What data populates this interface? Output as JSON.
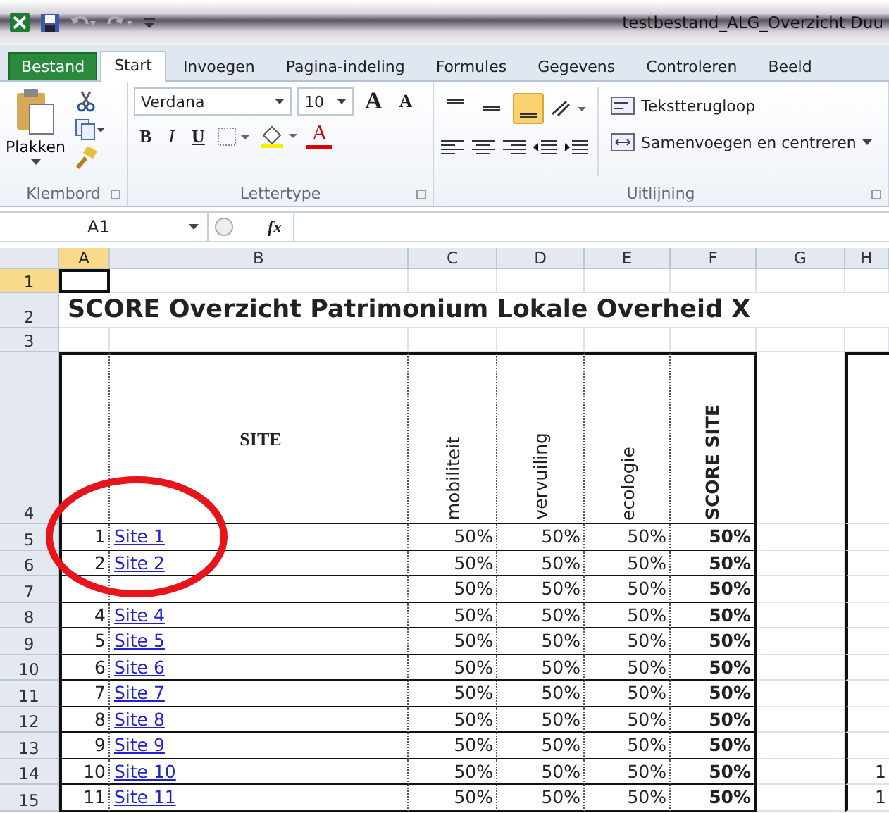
{
  "window": {
    "title": "testbestand_ALG_Overzicht Duu"
  },
  "tabs": [
    {
      "label": "Bestand",
      "kind": "file",
      "selected": false
    },
    {
      "label": "Start",
      "kind": "tab",
      "selected": true
    },
    {
      "label": "Invoegen",
      "kind": "tab",
      "selected": false
    },
    {
      "label": "Pagina-indeling",
      "kind": "tab",
      "selected": false
    },
    {
      "label": "Formules",
      "kind": "tab",
      "selected": false
    },
    {
      "label": "Gegevens",
      "kind": "tab",
      "selected": false
    },
    {
      "label": "Controleren",
      "kind": "tab",
      "selected": false
    },
    {
      "label": "Beeld",
      "kind": "tab",
      "selected": false
    }
  ],
  "ribbon": {
    "clipboard": {
      "paste": "Plakken",
      "group": "Klembord"
    },
    "font": {
      "family": "Verdana",
      "size": "10",
      "grow": "A",
      "shrink": "A",
      "bold": "B",
      "italic": "I",
      "underline": "U",
      "color_button": "A",
      "group": "Lettertype"
    },
    "alignment": {
      "vertical_align": [
        {
          "selected": false
        },
        {
          "selected": false
        },
        {
          "selected": true
        }
      ],
      "wrap": "Tekstterugloop",
      "merge": "Samenvoegen en centreren",
      "group": "Uitlijning"
    }
  },
  "formula_bar": {
    "name_box": "A1",
    "fx": "fx"
  },
  "sheet": {
    "columns": [
      {
        "label": "A",
        "selected": true
      },
      {
        "label": "B",
        "selected": false
      },
      {
        "label": "C",
        "selected": false
      },
      {
        "label": "D",
        "selected": false
      },
      {
        "label": "E",
        "selected": false
      },
      {
        "label": "F",
        "selected": false
      },
      {
        "label": "G",
        "selected": false
      },
      {
        "label": "H",
        "selected": false
      }
    ],
    "title_row": {
      "row": "2",
      "text": "SCORE Overzicht Patrimonium Lokale Overheid X"
    },
    "blank_rows": [
      {
        "row": "1",
        "selected": true
      },
      {
        "row": "3",
        "selected": false
      }
    ],
    "header": {
      "row": "4",
      "site": "SITE",
      "criteria": [
        "mobiliteit",
        "vervuiling",
        "ecologie"
      ],
      "score": "SCORE SITE"
    },
    "rows": [
      {
        "row": "5",
        "nr": "1",
        "site": "Site 1",
        "values": [
          "50%",
          "50%",
          "50%"
        ],
        "score": "50%"
      },
      {
        "row": "6",
        "nr": "2",
        "site": "Site 2",
        "values": [
          "50%",
          "50%",
          "50%"
        ],
        "score": "50%"
      },
      {
        "row": "7",
        "values": [
          "50%",
          "50%",
          "50%"
        ],
        "score": "50%"
      },
      {
        "row": "8",
        "nr": "4",
        "site": "Site 4",
        "values": [
          "50%",
          "50%",
          "50%"
        ],
        "score": "50%"
      },
      {
        "row": "9",
        "nr": "5",
        "site": "Site 5",
        "values": [
          "50%",
          "50%",
          "50%"
        ],
        "score": "50%"
      },
      {
        "row": "10",
        "nr": "6",
        "site": "Site 6",
        "values": [
          "50%",
          "50%",
          "50%"
        ],
        "score": "50%"
      },
      {
        "row": "11",
        "nr": "7",
        "site": "Site 7",
        "values": [
          "50%",
          "50%",
          "50%"
        ],
        "score": "50%"
      },
      {
        "row": "12",
        "nr": "8",
        "site": "Site 8",
        "values": [
          "50%",
          "50%",
          "50%"
        ],
        "score": "50%"
      },
      {
        "row": "13",
        "nr": "9",
        "site": "Site 9",
        "values": [
          "50%",
          "50%",
          "50%"
        ],
        "score": "50%"
      },
      {
        "row": "14",
        "nr": "10",
        "site": "Site 10",
        "values": [
          "50%",
          "50%",
          "50%"
        ],
        "score": "50%",
        "column_h": "1"
      },
      {
        "row": "15",
        "nr": "11",
        "site": "Site 11",
        "values": [
          "50%",
          "50%",
          "50%"
        ],
        "score": "50%",
        "column_h": "1"
      }
    ]
  }
}
